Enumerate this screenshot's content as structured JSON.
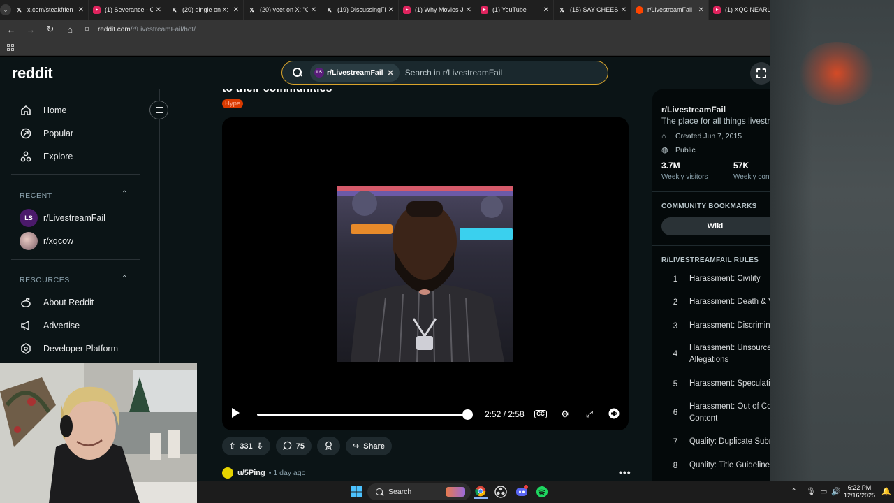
{
  "browser": {
    "tabs": [
      {
        "title": "x.com/steakfrien",
        "favicon": "x-icon",
        "active": false
      },
      {
        "title": "(1) Severance - O",
        "favicon": "youtube-icon",
        "active": false
      },
      {
        "title": "(20) dingle on X: \"",
        "favicon": "x-icon",
        "active": false
      },
      {
        "title": "(20) yeet on X: \"G",
        "favicon": "x-icon",
        "active": false
      },
      {
        "title": "(19) DiscussingFil",
        "favicon": "x-icon",
        "active": false
      },
      {
        "title": "(1) Why Movies Ju",
        "favicon": "youtube-icon",
        "active": false
      },
      {
        "title": "(1) YouTube",
        "favicon": "youtube-icon",
        "active": false
      },
      {
        "title": "(15) SAY CHEESE!",
        "favicon": "x-icon",
        "active": false
      },
      {
        "title": "r/LivestreamFail",
        "favicon": "reddit-icon",
        "active": true
      },
      {
        "title": "(1) XQC NEARLY",
        "favicon": "youtube-icon",
        "active": false
      }
    ],
    "url_host": "reddit.com",
    "url_path": "/r/LivestreamFail/hot/"
  },
  "header": {
    "logo": "reddit",
    "search_chip": "r/LivestreamFail",
    "search_chip_avatar": "LS",
    "search_placeholder": "Search in r/LivestreamFail"
  },
  "left_nav": {
    "items": [
      {
        "label": "Home",
        "icon": "home-icon"
      },
      {
        "label": "Popular",
        "icon": "popular-icon"
      },
      {
        "label": "Explore",
        "icon": "explore-icon"
      }
    ],
    "recent_heading": "RECENT",
    "recent": [
      {
        "label": "r/LivestreamFail",
        "avatar": "LS"
      },
      {
        "label": "r/xqcow",
        "avatar": ""
      }
    ],
    "resources_heading": "RESOURCES",
    "resources": [
      {
        "label": "About Reddit",
        "icon": "reddit-alien-icon"
      },
      {
        "label": "Advertise",
        "icon": "megaphone-icon"
      },
      {
        "label": "Developer Platform",
        "icon": "developer-icon"
      }
    ]
  },
  "post": {
    "title_fragment": "to their communities",
    "flair": "Hype",
    "video": {
      "current_time": "2:52",
      "duration": "2:58",
      "time_display": "2:52 / 2:58",
      "progress": 0.966
    },
    "upvotes": "331",
    "comments": "75",
    "share_label": "Share"
  },
  "next_post": {
    "user": "u/5Ping",
    "time": "1 day ago"
  },
  "right_sidebar": {
    "name": "r/LivestreamFail",
    "description": "The place for all things livestrea",
    "created": "Created Jun 7, 2015",
    "visibility": "Public",
    "stats": [
      {
        "value": "3.7M",
        "label": "Weekly visitors"
      },
      {
        "value": "57K",
        "label": "Weekly contr"
      }
    ],
    "bookmarks_heading": "COMMUNITY BOOKMARKS",
    "wiki_label": "Wiki",
    "rules_heading": "R/LIVESTREAMFAIL RULES",
    "rules": [
      {
        "num": "1",
        "text": "Harassment: Civility"
      },
      {
        "num": "2",
        "text": "Harassment: Death & V"
      },
      {
        "num": "3",
        "text": "Harassment: Discrimina"
      },
      {
        "num": "4",
        "text": "Harassment: Unsourced",
        "text2": "Allegations"
      },
      {
        "num": "5",
        "text": "Harassment: Speculatio"
      },
      {
        "num": "6",
        "text": "Harassment: Out of Co",
        "text2": "Content"
      },
      {
        "num": "7",
        "text": "Quality: Duplicate Subm"
      },
      {
        "num": "8",
        "text": "Quality: Title Guideline"
      }
    ]
  },
  "taskbar": {
    "search_label": "Search",
    "time": "6:22 PM",
    "date": "12/16/2025"
  },
  "colors": {
    "reddit_bg": "#0b1416",
    "search_border": "#d9a42b",
    "flair_bg": "#d93a00",
    "chrome_bg": "#353535"
  }
}
